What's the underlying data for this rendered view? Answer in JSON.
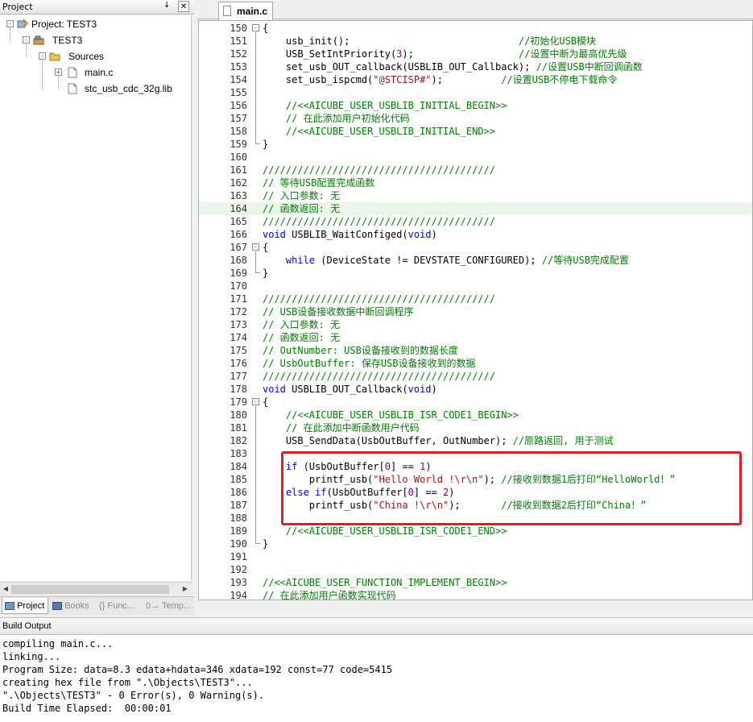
{
  "project_panel": {
    "title": "Project",
    "pin_glyph": "↓",
    "close_glyph": "✕",
    "tree": [
      {
        "label": "Project: TEST3",
        "icon": "project-workspace-icon",
        "expander": "-"
      },
      {
        "label": "TEST3",
        "icon": "target-icon",
        "expander": "-"
      },
      {
        "label": "Sources",
        "icon": "folder-icon",
        "expander": "-"
      },
      {
        "label": "main.c",
        "icon": "c-file-icon",
        "expander": "+"
      },
      {
        "label": "stc_usb_cdc_32g.lib",
        "icon": "lib-file-icon",
        "expander": ""
      }
    ],
    "tabs": [
      {
        "label": "Project",
        "icon": "project-tab-icon",
        "active": true
      },
      {
        "label": "Books",
        "icon": "books-icon",
        "active": false
      },
      {
        "label": "{} Func...",
        "icon": "functions-icon",
        "active": false
      },
      {
        "label": "0→ Temp...",
        "icon": "templates-icon",
        "active": false
      }
    ]
  },
  "editor": {
    "tab_label": "main.c",
    "highlight_line": 164,
    "lines": [
      {
        "n": "150",
        "segs": [
          {
            "t": "{",
            "c": ""
          }
        ]
      },
      {
        "n": "151",
        "segs": [
          {
            "t": "    usb_init();                             ",
            "c": ""
          },
          {
            "t": "//初始化USB模块",
            "c": "cm"
          }
        ]
      },
      {
        "n": "152",
        "segs": [
          {
            "t": "    USB_SetIntPriority(",
            "c": ""
          },
          {
            "t": "3",
            "c": "num"
          },
          {
            "t": ");                  ",
            "c": ""
          },
          {
            "t": "//设置中断为最高优先级",
            "c": "cm"
          }
        ]
      },
      {
        "n": "153",
        "segs": [
          {
            "t": "    set_usb_OUT_callback(USBLIB_OUT_Callback); ",
            "c": ""
          },
          {
            "t": "//设置USB中断回调函数",
            "c": "cm"
          }
        ]
      },
      {
        "n": "154",
        "segs": [
          {
            "t": "    set_usb_ispcmd(",
            "c": ""
          },
          {
            "t": "\"@STCISP#\"",
            "c": "str"
          },
          {
            "t": ");          ",
            "c": ""
          },
          {
            "t": "//设置USB不停电下载命令",
            "c": "cm"
          }
        ]
      },
      {
        "n": "155",
        "segs": [
          {
            "t": "",
            "c": ""
          }
        ]
      },
      {
        "n": "156",
        "segs": [
          {
            "t": "    ",
            "c": ""
          },
          {
            "t": "//<<AICUBE_USER_USBLIB_INITIAL_BEGIN>>",
            "c": "cm"
          }
        ]
      },
      {
        "n": "157",
        "segs": [
          {
            "t": "    ",
            "c": ""
          },
          {
            "t": "// 在此添加用户初始化代码",
            "c": "cm"
          }
        ]
      },
      {
        "n": "158",
        "segs": [
          {
            "t": "    ",
            "c": ""
          },
          {
            "t": "//<<AICUBE_USER_USBLIB_INITIAL_END>>",
            "c": "cm"
          }
        ]
      },
      {
        "n": "159",
        "segs": [
          {
            "t": "}",
            "c": ""
          }
        ]
      },
      {
        "n": "160",
        "segs": [
          {
            "t": "",
            "c": ""
          }
        ]
      },
      {
        "n": "161",
        "segs": [
          {
            "t": "////////////////////////////////////////",
            "c": "cm"
          }
        ]
      },
      {
        "n": "162",
        "segs": [
          {
            "t": "// 等待USB配置完成函数",
            "c": "cm"
          }
        ]
      },
      {
        "n": "163",
        "segs": [
          {
            "t": "// 入口参数: 无",
            "c": "cm"
          }
        ]
      },
      {
        "n": "164",
        "segs": [
          {
            "t": "// 函数返回: 无",
            "c": "cm"
          }
        ]
      },
      {
        "n": "165",
        "segs": [
          {
            "t": "////////////////////////////////////////",
            "c": "cm"
          }
        ]
      },
      {
        "n": "166",
        "segs": [
          {
            "t": "void",
            "c": "kw"
          },
          {
            "t": " USBLIB_WaitConfiged(",
            "c": ""
          },
          {
            "t": "void",
            "c": "kw"
          },
          {
            "t": ")",
            "c": ""
          }
        ]
      },
      {
        "n": "167",
        "segs": [
          {
            "t": "{",
            "c": ""
          }
        ]
      },
      {
        "n": "168",
        "segs": [
          {
            "t": "    ",
            "c": ""
          },
          {
            "t": "while",
            "c": "kw"
          },
          {
            "t": " (DeviceState != DEVSTATE_CONFIGURED); ",
            "c": ""
          },
          {
            "t": "//等待USB完成配置",
            "c": "cm"
          }
        ]
      },
      {
        "n": "169",
        "segs": [
          {
            "t": "}",
            "c": ""
          }
        ]
      },
      {
        "n": "170",
        "segs": [
          {
            "t": "",
            "c": ""
          }
        ]
      },
      {
        "n": "171",
        "segs": [
          {
            "t": "////////////////////////////////////////",
            "c": "cm"
          }
        ]
      },
      {
        "n": "172",
        "segs": [
          {
            "t": "// USB设备接收数据中断回调程序",
            "c": "cm"
          }
        ]
      },
      {
        "n": "173",
        "segs": [
          {
            "t": "// 入口参数: 无",
            "c": "cm"
          }
        ]
      },
      {
        "n": "174",
        "segs": [
          {
            "t": "// 函数返回: 无",
            "c": "cm"
          }
        ]
      },
      {
        "n": "175",
        "segs": [
          {
            "t": "// OutNumber: USB设备接收到的数据长度",
            "c": "cm"
          }
        ]
      },
      {
        "n": "176",
        "segs": [
          {
            "t": "// UsbOutBuffer: 保存USB设备接收到的数据",
            "c": "cm"
          }
        ]
      },
      {
        "n": "177",
        "segs": [
          {
            "t": "////////////////////////////////////////",
            "c": "cm"
          }
        ]
      },
      {
        "n": "178",
        "segs": [
          {
            "t": "void",
            "c": "kw"
          },
          {
            "t": " USBLIB_OUT_Callback(",
            "c": ""
          },
          {
            "t": "void",
            "c": "kw"
          },
          {
            "t": ")",
            "c": ""
          }
        ]
      },
      {
        "n": "179",
        "segs": [
          {
            "t": "{",
            "c": ""
          }
        ]
      },
      {
        "n": "180",
        "segs": [
          {
            "t": "    ",
            "c": ""
          },
          {
            "t": "//<<AICUBE_USER_USBLIB_ISR_CODE1_BEGIN>>",
            "c": "cm"
          }
        ]
      },
      {
        "n": "181",
        "segs": [
          {
            "t": "    ",
            "c": ""
          },
          {
            "t": "// 在此添加中断函数用户代码",
            "c": "cm"
          }
        ]
      },
      {
        "n": "182",
        "segs": [
          {
            "t": "    USB_SendData(UsbOutBuffer, OutNumber); ",
            "c": ""
          },
          {
            "t": "//原路返回, 用于测试",
            "c": "cm"
          }
        ]
      },
      {
        "n": "183",
        "segs": [
          {
            "t": "",
            "c": ""
          }
        ]
      },
      {
        "n": "184",
        "segs": [
          {
            "t": "    ",
            "c": ""
          },
          {
            "t": "if",
            "c": "kw"
          },
          {
            "t": " (UsbOutBuffer[",
            "c": ""
          },
          {
            "t": "0",
            "c": "num"
          },
          {
            "t": "] == ",
            "c": ""
          },
          {
            "t": "1",
            "c": "num"
          },
          {
            "t": ")",
            "c": ""
          }
        ]
      },
      {
        "n": "185",
        "segs": [
          {
            "t": "        printf_usb(",
            "c": ""
          },
          {
            "t": "\"Hello World !\\r\\n\"",
            "c": "str"
          },
          {
            "t": "); ",
            "c": ""
          },
          {
            "t": "//接收到数据1后打印“HelloWorld！”",
            "c": "cm"
          }
        ]
      },
      {
        "n": "186",
        "segs": [
          {
            "t": "    ",
            "c": ""
          },
          {
            "t": "else",
            "c": "kw"
          },
          {
            "t": " ",
            "c": ""
          },
          {
            "t": "if",
            "c": "kw"
          },
          {
            "t": "(UsbOutBuffer[",
            "c": ""
          },
          {
            "t": "0",
            "c": "num"
          },
          {
            "t": "] == ",
            "c": ""
          },
          {
            "t": "2",
            "c": "num"
          },
          {
            "t": ")",
            "c": ""
          }
        ]
      },
      {
        "n": "187",
        "segs": [
          {
            "t": "        printf_usb(",
            "c": ""
          },
          {
            "t": "\"China !\\r\\n\"",
            "c": "str"
          },
          {
            "t": ");       ",
            "c": ""
          },
          {
            "t": "//接收到数据2后打印“China！”",
            "c": "cm"
          }
        ]
      },
      {
        "n": "188",
        "segs": [
          {
            "t": "",
            "c": ""
          }
        ]
      },
      {
        "n": "189",
        "segs": [
          {
            "t": "    ",
            "c": ""
          },
          {
            "t": "//<<AICUBE_USER_USBLIB_ISR_CODE1_END>>",
            "c": "cm"
          }
        ]
      },
      {
        "n": "190",
        "segs": [
          {
            "t": "}",
            "c": ""
          }
        ]
      },
      {
        "n": "191",
        "segs": [
          {
            "t": "",
            "c": ""
          }
        ]
      },
      {
        "n": "192",
        "segs": [
          {
            "t": "",
            "c": ""
          }
        ]
      },
      {
        "n": "193",
        "segs": [
          {
            "t": "//<<AICUBE_USER_FUNCTION_IMPLEMENT_BEGIN>>",
            "c": "cm"
          }
        ]
      },
      {
        "n": "194",
        "segs": [
          {
            "t": "// 在此添加用户函数实现代码",
            "c": "cm"
          }
        ]
      }
    ]
  },
  "build_output": {
    "title": "Build Output",
    "lines": [
      "compiling main.c...",
      "linking...",
      "Program Size: data=8.3 edata+hdata=346 xdata=192 const=77 code=5415",
      "creating hex file from \".\\Objects\\TEST3\"...",
      "\".\\Objects\\TEST3\" - 0 Error(s), 0 Warning(s).",
      "Build Time Elapsed:  00:00:01"
    ]
  },
  "colors": {
    "comment": "#008000",
    "keyword": "#0000ff",
    "string": "#a31515",
    "number": "#800080",
    "annotation_box": "#e02020",
    "highlight_line": "#e8f7e8"
  }
}
